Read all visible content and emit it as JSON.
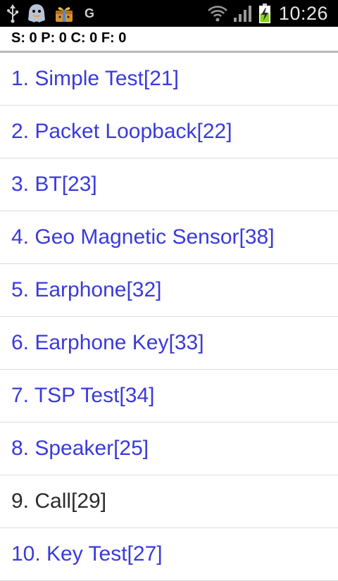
{
  "status_bar": {
    "left_icons": [
      "usb-icon",
      "ghost-app-icon",
      "gift-box-icon"
    ],
    "network_letter": "G",
    "right_icons": [
      "wifi-icon",
      "cell-signal-icon",
      "battery-charging-icon"
    ],
    "time": "10:26"
  },
  "counters": {
    "text": "S: 0 P: 0 C: 0 F: 0"
  },
  "tests": [
    {
      "label": "1. Simple Test[21]",
      "color": "#3a3adb"
    },
    {
      "label": "2. Packet Loopback[22]",
      "color": "#3a3adb"
    },
    {
      "label": "3. BT[23]",
      "color": "#3a3adb"
    },
    {
      "label": "4. Geo Magnetic Sensor[38]",
      "color": "#3a3adb"
    },
    {
      "label": "5. Earphone[32]",
      "color": "#3a3adb"
    },
    {
      "label": "6. Earphone Key[33]",
      "color": "#3a3adb"
    },
    {
      "label": "7. TSP Test[34]",
      "color": "#3a3adb"
    },
    {
      "label": "8. Speaker[25]",
      "color": "#3a3adb"
    },
    {
      "label": "9. Call[29]",
      "color": "#2b2b2b"
    },
    {
      "label": "10. Key Test[27]",
      "color": "#3a3adb"
    }
  ],
  "colors": {
    "status_bar_bg": "#000000",
    "link_blue": "#3a3adb",
    "plain_text": "#2b2b2b",
    "divider": "#dcdcdc",
    "battery_green": "#8bd21c"
  }
}
